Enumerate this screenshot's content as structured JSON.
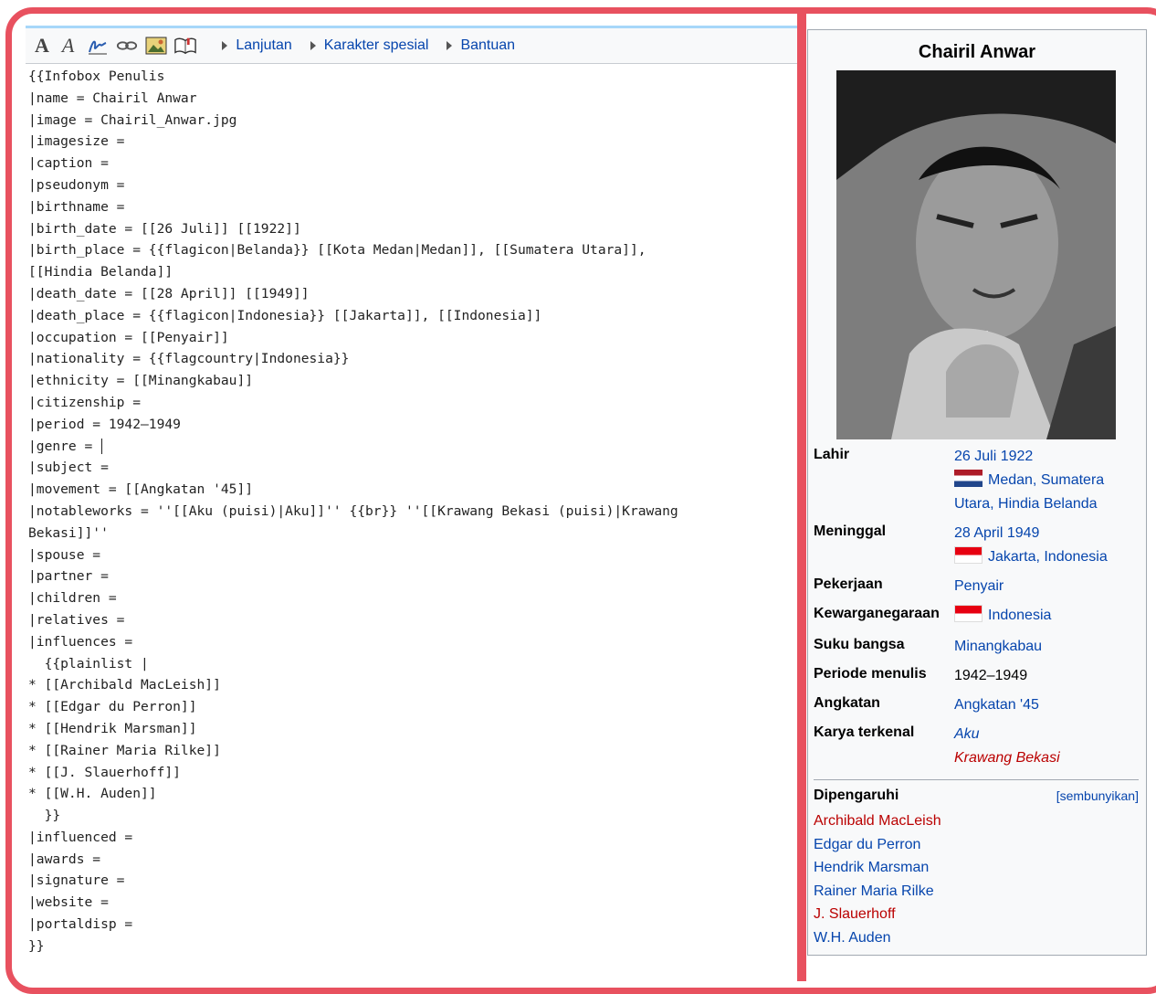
{
  "toolbar": {
    "bold_label": "A",
    "italic_label": "A",
    "icons": [
      "signature-icon",
      "link-icon",
      "image-icon",
      "reference-icon"
    ],
    "menus": [
      "Lanjutan",
      "Karakter spesial",
      "Bantuan"
    ]
  },
  "editor": {
    "lines": [
      "{{Infobox Penulis",
      "|name = Chairil Anwar",
      "|image = Chairil_Anwar.jpg",
      "|imagesize =",
      "|caption =",
      "|pseudonym =",
      "|birthname =",
      "|birth_date = [[26 Juli]] [[1922]]",
      "|birth_place = {{flagicon|Belanda}} [[Kota Medan|Medan]], [[Sumatera Utara]],",
      "[[Hindia Belanda]]",
      "|death_date = [[28 April]] [[1949]]",
      "|death_place = {{flagicon|Indonesia}} [[Jakarta]], [[Indonesia]]",
      "|occupation = [[Penyair]]",
      "|nationality = {{flagcountry|Indonesia}}",
      "|ethnicity = [[Minangkabau]]",
      "|citizenship =",
      "|period = 1942–1949",
      "|genre = ",
      "|subject =",
      "|movement = [[Angkatan '45]]",
      "|notableworks = ''[[Aku (puisi)|Aku]]'' {{br}} ''[[Krawang Bekasi (puisi)|Krawang",
      "Bekasi]]''",
      "|spouse =",
      "|partner =",
      "|children =",
      "|relatives =",
      "|influences =",
      "  {{plainlist |",
      "* [[Archibald MacLeish]]",
      "* [[Edgar du Perron]]",
      "* [[Hendrik Marsman]]",
      "* [[Rainer Maria Rilke]]",
      "* [[J. Slauerhoff]]",
      "* [[W.H. Auden]]",
      "  }}",
      "|influenced =",
      "|awards =",
      "|signature =",
      "|website =",
      "|portaldisp =",
      "}}"
    ]
  },
  "infobox": {
    "title": "Chairil Anwar",
    "lahir_label": "Lahir",
    "lahir_date": "26 Juli 1922",
    "lahir_place_1": "Medan, Sumatera",
    "lahir_place_2": "Utara, Hindia Belanda",
    "meninggal_label": "Meninggal",
    "meninggal_date": "28 April 1949",
    "meninggal_place": "Jakarta, Indonesia",
    "pekerjaan_label": "Pekerjaan",
    "pekerjaan_value": "Penyair",
    "kewarga_label": "Kewarganegaraan",
    "kewarga_value": "Indonesia",
    "suku_label": "Suku bangsa",
    "suku_value": "Minangkabau",
    "periode_label": "Periode menulis",
    "periode_value": "1942–1949",
    "angkatan_label": "Angkatan",
    "angkatan_value": "Angkatan '45",
    "karya_label": "Karya terkenal",
    "karya_1": "Aku",
    "karya_2": "Krawang Bekasi",
    "dipengaruhi_label": "Dipengaruhi",
    "hide_label": "[sembunyikan]",
    "influences": [
      {
        "name": "Archibald MacLeish",
        "color": "#ba0000"
      },
      {
        "name": "Edgar du Perron",
        "color": "#0645ad"
      },
      {
        "name": "Hendrik Marsman",
        "color": "#0645ad"
      },
      {
        "name": "Rainer Maria Rilke",
        "color": "#0645ad"
      },
      {
        "name": "J. Slauerhoff",
        "color": "#ba0000"
      },
      {
        "name": "W.H. Auden",
        "color": "#0645ad"
      }
    ]
  },
  "colors": {
    "frame": "#e8515f",
    "link": "#0645ad",
    "redlink": "#ba0000"
  }
}
